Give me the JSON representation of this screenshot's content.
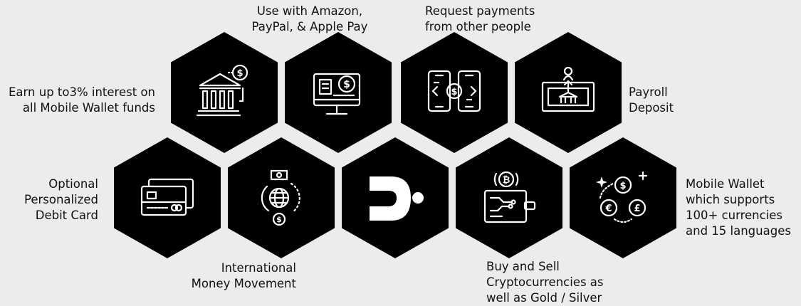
{
  "features": [
    {
      "id": "interest",
      "icon": "bank-icon",
      "label_lines": [
        "Earn up to3% interest on",
        "all Mobile Wallet funds"
      ]
    },
    {
      "id": "amazon",
      "icon": "monitor-dollar-icon",
      "label_lines": [
        "Use with Amazon,",
        "PayPal, & Apple Pay"
      ]
    },
    {
      "id": "request",
      "icon": "phone-exchange-icon",
      "label_lines": [
        "Request payments",
        "from other people"
      ]
    },
    {
      "id": "payroll",
      "icon": "payroll-deposit-icon",
      "label_lines": [
        "Payroll",
        "Deposit"
      ]
    },
    {
      "id": "debit",
      "icon": "debit-card-icon",
      "label_lines": [
        "Optional",
        "Personalized",
        "Debit Card"
      ]
    },
    {
      "id": "international",
      "icon": "globe-transfer-icon",
      "label_lines": [
        "International",
        "Money Movement"
      ]
    },
    {
      "id": "brand",
      "icon": "brand-logo-icon",
      "label_lines": []
    },
    {
      "id": "crypto",
      "icon": "bitcoin-circuit-icon",
      "label_lines": [
        "Buy and Sell",
        "Cryptocurrencies as",
        "well as Gold / Silver"
      ]
    },
    {
      "id": "currencies",
      "icon": "currency-coins-icon",
      "label_lines": [
        "Mobile Wallet",
        "which supports",
        "100+ currencies",
        "and 15 languages"
      ]
    }
  ]
}
